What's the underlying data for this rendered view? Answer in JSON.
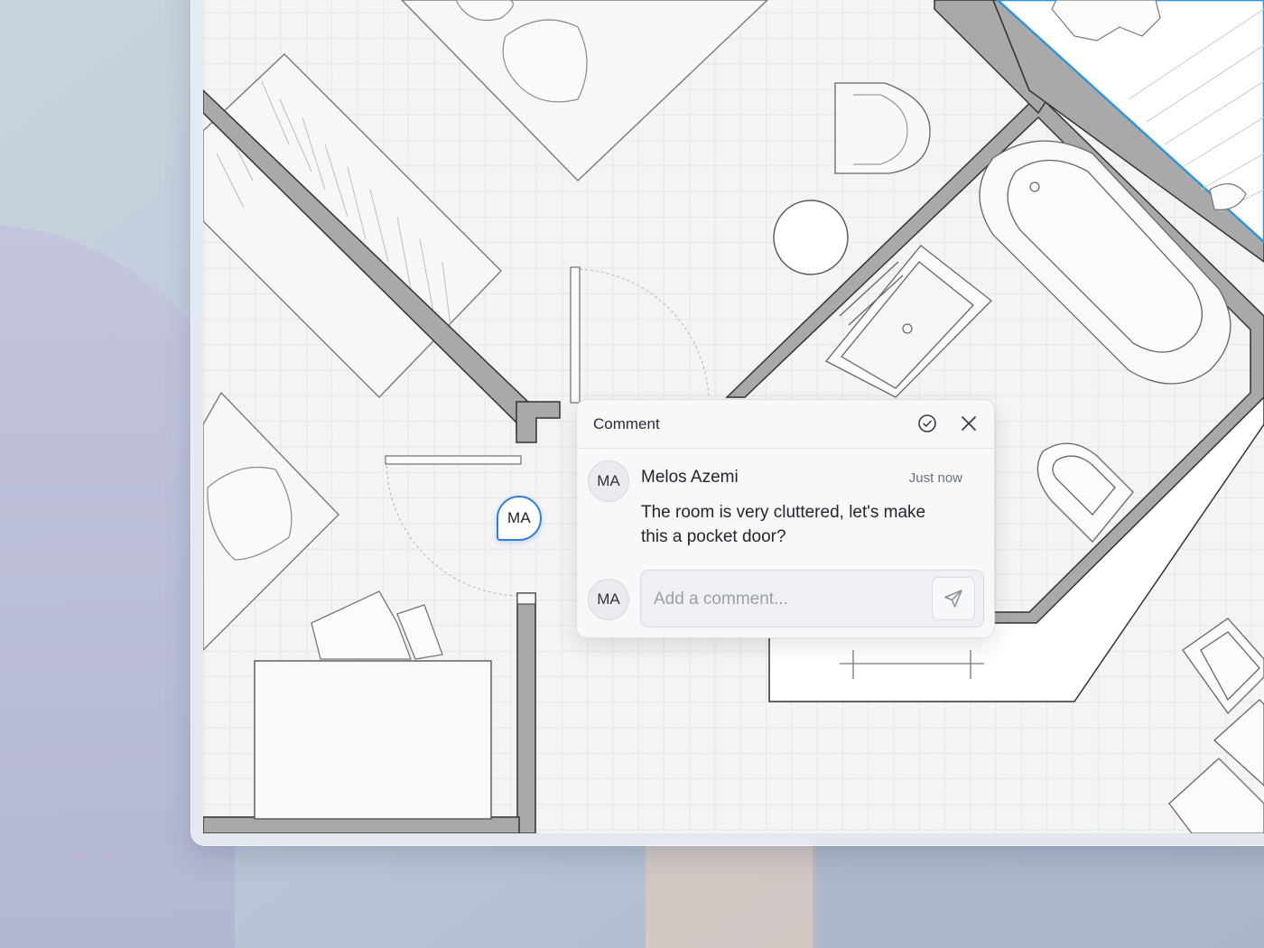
{
  "comment_pin": {
    "initials": "MA"
  },
  "comment_popover": {
    "title": "Comment",
    "resolve_icon": "check-circle-icon",
    "close_icon": "close-icon",
    "comment": {
      "author_initials": "MA",
      "author_name": "Melos Azemi",
      "timestamp": "Just now",
      "body": "The room is very cluttered, let's make this a pocket door?"
    },
    "reply": {
      "user_initials": "MA",
      "placeholder": "Add a comment...",
      "value": "",
      "send_icon": "send-icon"
    }
  },
  "colors": {
    "accent": "#2f7de1",
    "wall_fill": "#a9a9a9",
    "canvas_bg": "#f4f4f4"
  }
}
